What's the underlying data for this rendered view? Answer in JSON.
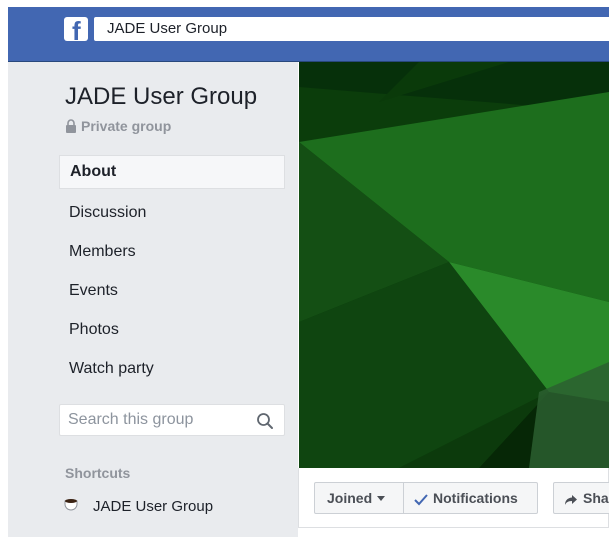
{
  "header": {
    "logo_letter": "f",
    "search_value": "JADE User Group",
    "colors": {
      "bar": "#4267b2",
      "sidebar_bg": "#e9ebee"
    }
  },
  "group": {
    "name": "JADE User Group",
    "privacy": "Private group"
  },
  "nav": {
    "items": [
      {
        "label": "About",
        "active": true
      },
      {
        "label": "Discussion"
      },
      {
        "label": "Members"
      },
      {
        "label": "Events"
      },
      {
        "label": "Photos"
      },
      {
        "label": "Watch party"
      }
    ]
  },
  "group_search": {
    "placeholder": "Search this group"
  },
  "shortcuts": {
    "label": "Shortcuts",
    "items": [
      {
        "label": "JADE User Group",
        "icon": "coffee-cup-icon"
      }
    ]
  },
  "actions": {
    "joined": "Joined",
    "notifications": "Notifications",
    "share": "Share"
  }
}
